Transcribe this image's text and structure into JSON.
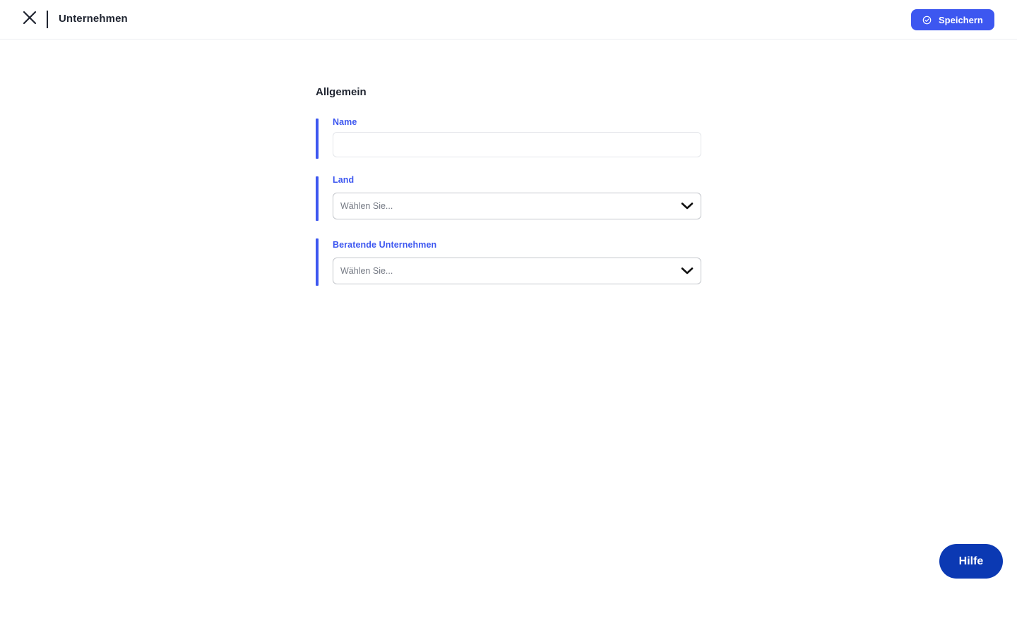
{
  "header": {
    "title": "Unternehmen",
    "close_icon": "close-icon",
    "save_label": "Speichern",
    "save_icon": "check-circle-icon",
    "accent": "#3d57f0"
  },
  "form": {
    "section_title": "Allgemein",
    "fields": [
      {
        "label": "Name",
        "type": "text",
        "value": "",
        "placeholder": ""
      },
      {
        "label": "Land",
        "type": "select",
        "placeholder": "Wählen Sie..."
      },
      {
        "label": "Beratende Unternehmen",
        "type": "select",
        "placeholder": "Wählen Sie..."
      }
    ]
  },
  "help": {
    "label": "Hilfe",
    "color": "#0b39b3"
  }
}
